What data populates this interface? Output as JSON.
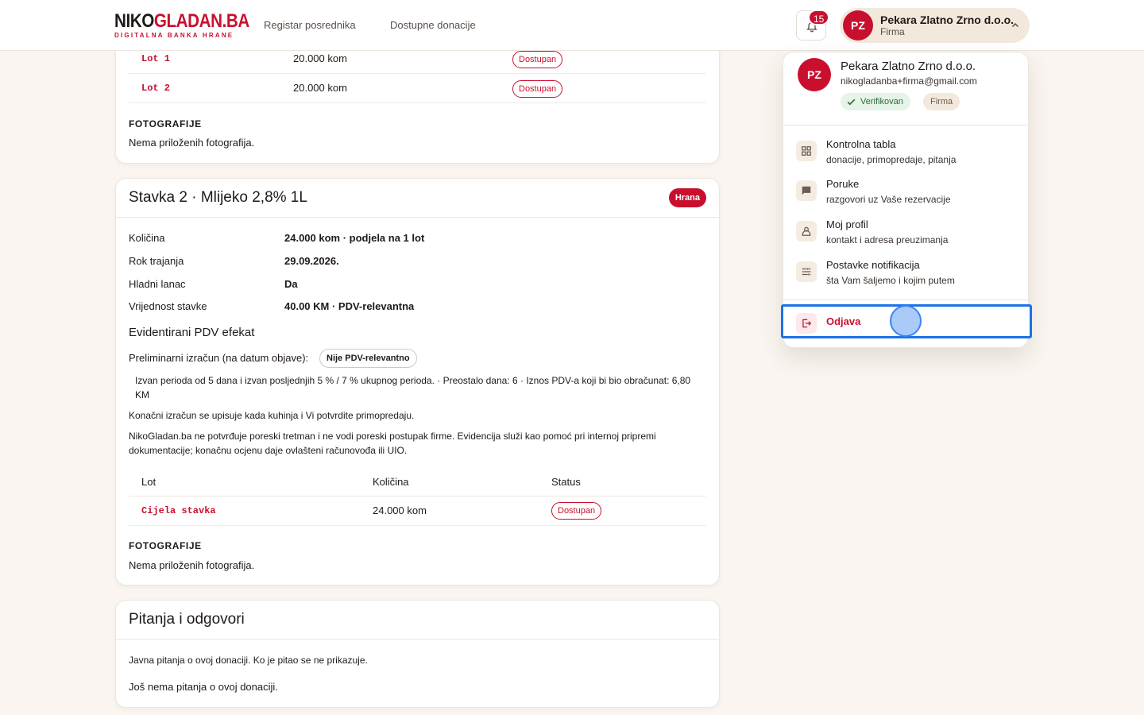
{
  "header": {
    "logo_main_black": "NIKO",
    "logo_main_red": "GLADAN.BA",
    "logo_sub": "DIGITALNA BANKA HRANE",
    "nav": [
      "Registar posrednika",
      "Dostupne donacije"
    ],
    "notifications_count": "15",
    "user": {
      "initials": "PZ",
      "name": "Pekara Zlatno Zrno d.o.o.",
      "role": "Firma"
    }
  },
  "item1": {
    "lots": [
      {
        "code": "Lot 1",
        "qty": "20.000 kom",
        "status": "Dostupan"
      },
      {
        "code": "Lot 2",
        "qty": "20.000 kom",
        "status": "Dostupan"
      }
    ],
    "photos_heading": "FOTOGRAFIJE",
    "photos_empty": "Nema priloženih fotografija."
  },
  "item2": {
    "title": "Stavka 2 · Mlijeko 2,8% 1L",
    "category": "Hrana",
    "details": [
      {
        "label": "Količina",
        "value": "24.000 kom · podjela na 1 lot"
      },
      {
        "label": "Rok trajanja",
        "value": "29.09.2026."
      },
      {
        "label": "Hladni lanac",
        "value": "Da"
      },
      {
        "label": "Vrijednost stavke",
        "value": "40.00 KM · PDV-relevantna"
      }
    ],
    "vat_heading": "Evidentirani PDV efekat",
    "prelim_label": "Preliminarni izračun (na datum objave):",
    "prelim_badge": "Nije PDV-relevantno",
    "prelim_note": "Izvan perioda od 5 dana i izvan posljednjih 5 % / 7 % ukupnog perioda. · Preostalo dana: 6 · Iznos PDV-a koji bi bio obračunat: 6,80 KM",
    "final_note": "Konačni izračun se upisuje kada kuhinja i Vi potvrdite primopredaju.",
    "disclaimer": "NikoGladan.ba ne potvrđuje poreski tretman i ne vodi poreski postupak firme. Evidencija služi kao pomoć pri internoj pripremi dokumentacije; konačnu ocjenu daje ovlašteni računovođa ili UIO.",
    "table_headers": [
      "Lot",
      "Količina",
      "Status"
    ],
    "lots": [
      {
        "code": "Cijela stavka",
        "qty": "24.000 kom",
        "status": "Dostupan"
      }
    ],
    "photos_heading": "FOTOGRAFIJE",
    "photos_empty": "Nema priloženih fotografija."
  },
  "qa": {
    "title": "Pitanja i odgovori",
    "intro": "Javna pitanja o ovoj donaciji. Ko je pitao se ne prikazuje.",
    "empty": "Još nema pitanja o ovoj donaciji."
  },
  "dropdown": {
    "initials": "PZ",
    "name": "Pekara Zlatno Zrno d.o.o.",
    "email": "nikogladanba+firma@gmail.com",
    "verified": "Verifikovan",
    "role": "Firma",
    "items": [
      {
        "icon": "dashboard-icon",
        "title": "Kontrolna tabla",
        "sub": "donacije, primopredaje, pitanja"
      },
      {
        "icon": "chat-icon",
        "title": "Poruke",
        "sub": "razgovori uz Vaše rezervacije"
      },
      {
        "icon": "person-icon",
        "title": "Moj profil",
        "sub": "kontakt i adresa preuzimanja"
      },
      {
        "icon": "tune-icon",
        "title": "Postavke notifikacija",
        "sub": "šta Vam šaljemo i kojim putem"
      }
    ],
    "logout": "Odjava"
  },
  "colors": {
    "brand": "#c8102e",
    "background": "#faf5f0",
    "focus": "#1a73e8"
  }
}
